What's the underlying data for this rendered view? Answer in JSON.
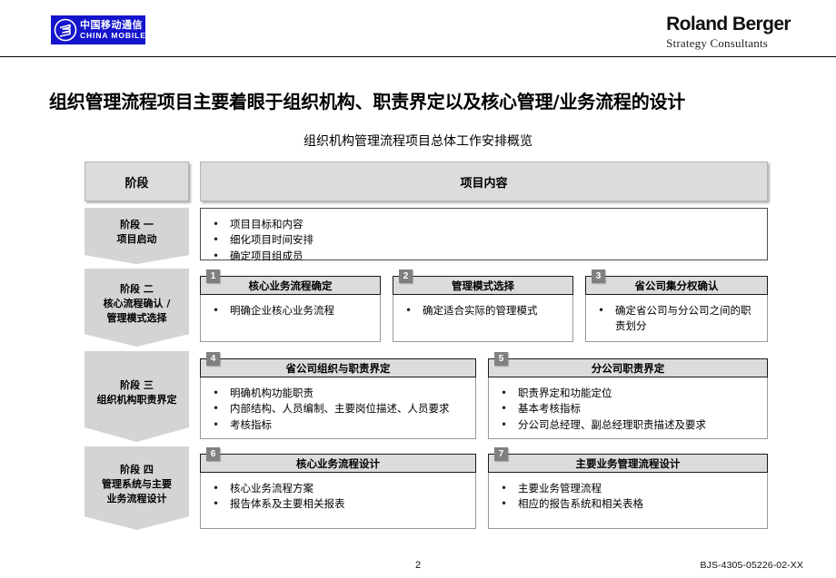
{
  "header": {
    "china_mobile": {
      "logo_icon": "china-mobile-logo-icon",
      "cn_name": "中国移动通信",
      "en_name": "CHINA MOBILE",
      "bg_color": "#1414cc"
    },
    "roland_berger": {
      "name": "Roland Berger",
      "tagline": "Strategy Consultants"
    }
  },
  "page_title": "组织管理流程项目主要着眼于组织机构、职责界定以及核心管理/业务流程的设计",
  "subtitle": "组织机构管理流程项目总体工作安排概览",
  "table_headers": {
    "stage": "阶段",
    "content": "项目内容"
  },
  "phases": [
    {
      "label_lines": [
        "阶段 一",
        "项目启动"
      ],
      "cards": [
        {
          "number": "",
          "title": "",
          "bullets": [
            "项目目标和内容",
            "细化项目时间安排",
            "确定项目组成员"
          ]
        }
      ]
    },
    {
      "label_lines": [
        "阶段 二",
        "核心流程确认 /",
        "管理模式选择"
      ],
      "cards": [
        {
          "number": "1",
          "title": "核心业务流程确定",
          "bullets": [
            "明确企业核心业务流程"
          ]
        },
        {
          "number": "2",
          "title": "管理模式选择",
          "bullets": [
            "确定适合实际的管理模式"
          ]
        },
        {
          "number": "3",
          "title": "省公司集分权确认",
          "bullets": [
            "确定省公司与分公司之间的职责划分"
          ]
        }
      ]
    },
    {
      "label_lines": [
        "阶段 三",
        "组织机构职责界定"
      ],
      "cards": [
        {
          "number": "4",
          "title": "省公司组织与职责界定",
          "bullets": [
            "明确机构功能职责",
            "内部结构、人员编制、主要岗位描述、人员要求",
            "考核指标"
          ]
        },
        {
          "number": "5",
          "title": "分公司职责界定",
          "bullets": [
            "职责界定和功能定位",
            "基本考核指标",
            "分公司总经理、副总经理职责描述及要求"
          ]
        }
      ]
    },
    {
      "label_lines": [
        "阶段 四",
        "管理系统与主要",
        "业务流程设计"
      ],
      "cards": [
        {
          "number": "6",
          "title": "核心业务流程设计",
          "bullets": [
            "核心业务流程方案",
            "报告体系及主要相关报表"
          ]
        },
        {
          "number": "7",
          "title": "主要业务管理流程设计",
          "bullets": [
            "主要业务管理流程",
            "相应的报告系统和相关表格"
          ]
        }
      ]
    }
  ],
  "footer": {
    "page_number": "2",
    "document_code": "BJS-4305-05226-02-XX"
  }
}
